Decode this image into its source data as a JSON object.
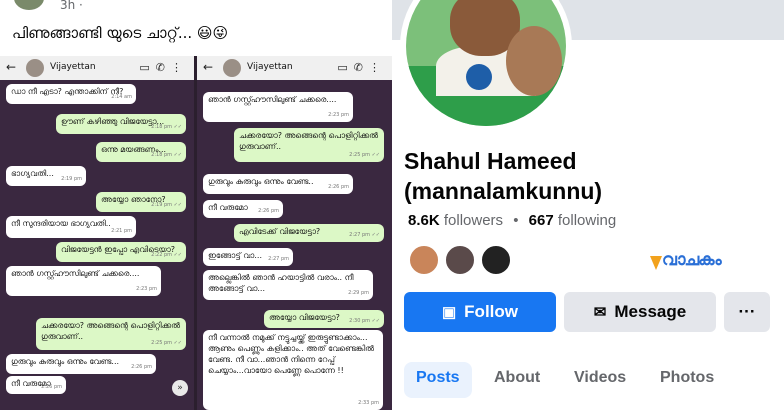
{
  "post": {
    "time": "3h ·",
    "caption": "പിണുങ്ങാണ്ടി യുടെ ചാറ്റ്... 😃😜"
  },
  "chat": {
    "contact_name": "Vijayettan",
    "left_messages": [
      {
        "dir": "in",
        "text": "ഡാ നീ എടാ? എന്താക്കിന് നീ?",
        "time": "2:14 am"
      },
      {
        "dir": "out",
        "text": "ഊണ് കഴിഞ്ഞു വിജയേട്ടാ...",
        "time": "2:18 pm ✓✓"
      },
      {
        "dir": "out",
        "text": "ഒന്നു മയങ്ങണം...",
        "time": "2:18 pm ✓✓"
      },
      {
        "dir": "in",
        "text": "ഭാഗ്യവതി...",
        "time": "2:19 pm"
      },
      {
        "dir": "out",
        "text": "അയ്യോ ഞാനോ?",
        "time": "2:19 pm ✓✓"
      },
      {
        "dir": "in",
        "text": "നീ സുന്ദരിയായ ഭാഗ്യവതി..",
        "time": "2:21 pm"
      },
      {
        "dir": "out",
        "text": "വിജയേട്ടൻ ഇപ്പോ എവിടെയാ?",
        "time": "2:22 pm ✓✓"
      },
      {
        "dir": "in",
        "text": "ഞാൻ ഗസ്റ്റ്ഹൗസിലുണ്ട് ചക്കരെ....",
        "time": "2:23 pm"
      },
      {
        "dir": "out",
        "text": "ചക്കരയോ? അങ്ങെന്റെ പൊളിറ്റിക്കൽ ഗുരുവാണ്..",
        "time": "2:25 pm ✓✓"
      },
      {
        "dir": "in",
        "text": "ഗുരുവും കുരുവും ഒന്നും വേണ്ട...",
        "time": "2:26 pm"
      },
      {
        "dir": "in",
        "text": "നീ വരുമോ",
        "time": "2:26 pm"
      }
    ],
    "right_messages": [
      {
        "dir": "in",
        "text": "ഞാൻ ഗസ്റ്റ്ഹൗസിലുണ്ട് ചക്കരെ....",
        "time": "2:23 pm"
      },
      {
        "dir": "out",
        "text": "ചക്കരയോ? അങ്ങെന്റെ പൊളിറ്റിക്കൽ ഗുരുവാണ്..",
        "time": "2:25 pm ✓✓"
      },
      {
        "dir": "in",
        "text": "ഗുരുവും കുരുവും ഒന്നും വേണ്ട..",
        "time": "2:26 pm"
      },
      {
        "dir": "in",
        "text": "നീ വരുമോ",
        "time": "2:26 pm"
      },
      {
        "dir": "out",
        "text": "എവിടേക്ക് വിജയേട്ടാ?",
        "time": "2:27 pm ✓✓"
      },
      {
        "dir": "in",
        "text": "ഇങ്ങോട്ട് വാ...",
        "time": "2:27 pm"
      },
      {
        "dir": "in",
        "text": "അല്ലെങ്കിൽ ഞാൻ ഹയാട്ടിൽ വരാം.. നീ അങ്ങോട്ട് വാ...",
        "time": "2:29 pm"
      },
      {
        "dir": "out",
        "text": "അയ്യോ വിജയേട്ടാ?",
        "time": "2:30 pm ✓✓"
      },
      {
        "dir": "in",
        "text": "നീ വന്നാൽ നമുക്ക് നട്ടുച്ചയ്ക്ക് ഇരുട്ടുണ്ടാക്കാം... ആണും പെണ്ണും കളിക്കാം.. അത് വേണ്ടെങ്കിൽ വേണ്ട. നീ വാ...ഞാൻ നിന്നെ റേപ്പ് ചെയ്യാം...വായോ പെണ്ണേ പൊന്നേ !!",
        "time": "2:33 pm"
      }
    ]
  },
  "profile": {
    "name": "Shahul Hameed (mannalamkunnu)",
    "followers_count": "8.6K",
    "followers_label": "followers",
    "separator": "•",
    "following_count": "667",
    "following_label": "following",
    "watermark_text": "വാചകം",
    "follow_label": "Follow",
    "message_label": "Message",
    "more_label": "···",
    "tabs": [
      "Posts",
      "About",
      "Videos",
      "Photos"
    ],
    "active_tab": "Posts",
    "accent_color": "#1877f2"
  }
}
